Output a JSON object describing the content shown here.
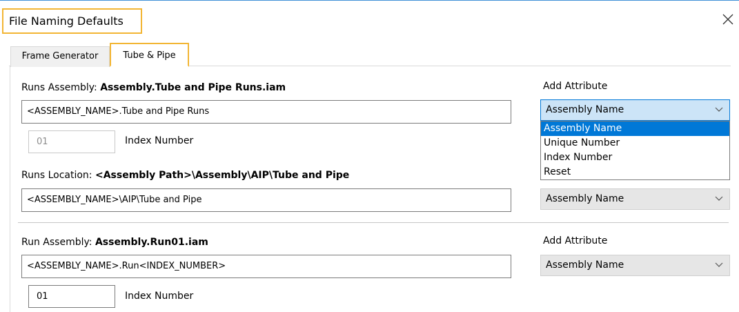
{
  "dialog": {
    "title": "File Naming Defaults"
  },
  "tabs": [
    {
      "label": "Frame Generator",
      "active": false
    },
    {
      "label": "Tube & Pipe",
      "active": true
    }
  ],
  "runs_assembly": {
    "label": "Runs Assembly:",
    "value_preview": "Assembly.Tube and Pipe Runs.iam",
    "template": "<ASSEMBLY_NAME>.Tube and Pipe Runs",
    "index_value": "01",
    "index_label": "Index Number",
    "add_attribute_label": "Add Attribute",
    "attribute_selected": "Assembly Name",
    "attribute_options": [
      "Assembly Name",
      "Unique Number",
      "Index Number",
      "Reset"
    ]
  },
  "runs_location": {
    "label": "Runs Location:",
    "value_preview": "<Assembly Path>\\Assembly\\AIP\\Tube and Pipe",
    "template": "<ASSEMBLY_NAME>\\AIP\\Tube and Pipe",
    "attribute_selected": "Assembly Name"
  },
  "run_assembly": {
    "label": "Run Assembly:",
    "value_preview": "Assembly.Run01.iam",
    "template": "<ASSEMBLY_NAME>.Run<INDEX_NUMBER>",
    "index_value": "01",
    "index_label": "Index Number",
    "add_attribute_label": "Add Attribute",
    "attribute_selected": "Assembly Name"
  },
  "colors": {
    "highlight_border": "#f2b533",
    "dropdown_selection": "#0078d7",
    "open_select_bg": "#cce4f7"
  },
  "icons": {
    "close": "close-icon",
    "dropdown_arrow": "chevron-down-icon"
  }
}
